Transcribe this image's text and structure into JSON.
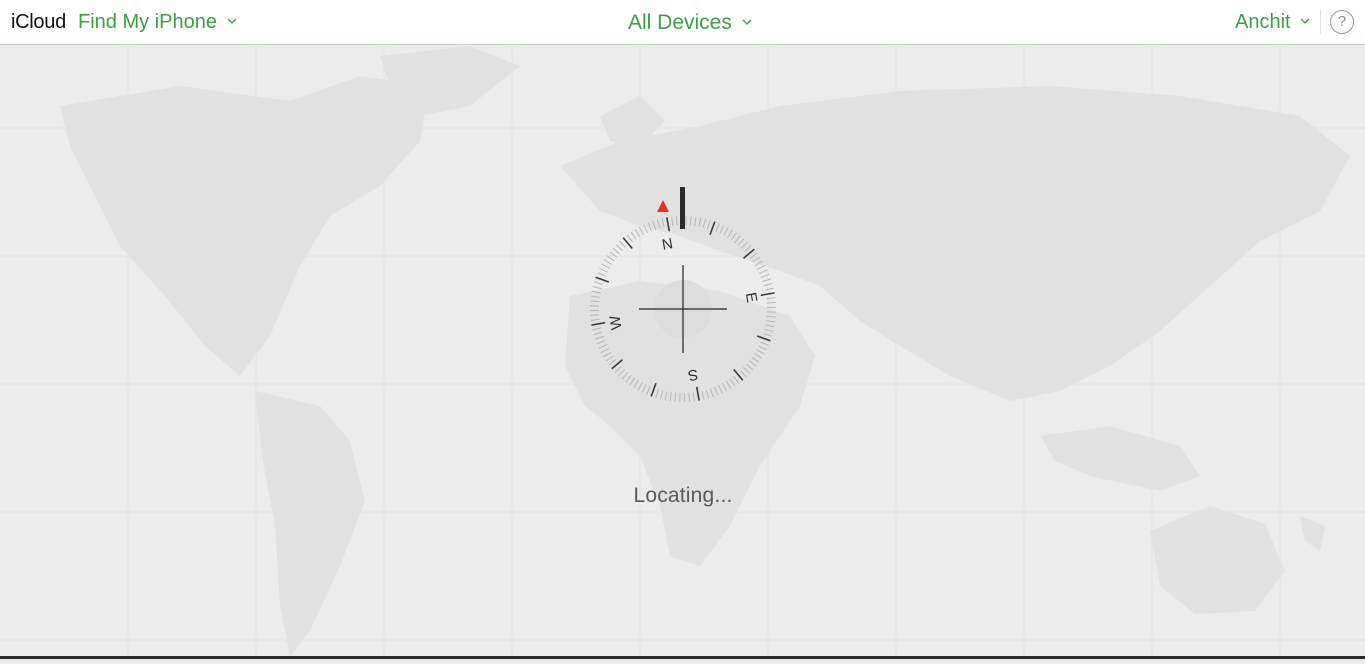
{
  "header": {
    "brand": "iCloud",
    "app_name": "Find My iPhone",
    "devices_label": "All Devices",
    "user_name": "Anchit",
    "help_symbol": "?"
  },
  "compass": {
    "north": "N",
    "east": "E",
    "south": "S",
    "west": "W"
  },
  "status": {
    "message": "Locating..."
  },
  "icons": [
    "chevron-down-icon",
    "help-icon",
    "compass-icon",
    "north-pointer-icon",
    "crosshair-icon"
  ],
  "colors": {
    "accent": "#3aa142",
    "map_background": "#ececec",
    "land": "#e0e0e0",
    "pointer": "#e8321e"
  }
}
